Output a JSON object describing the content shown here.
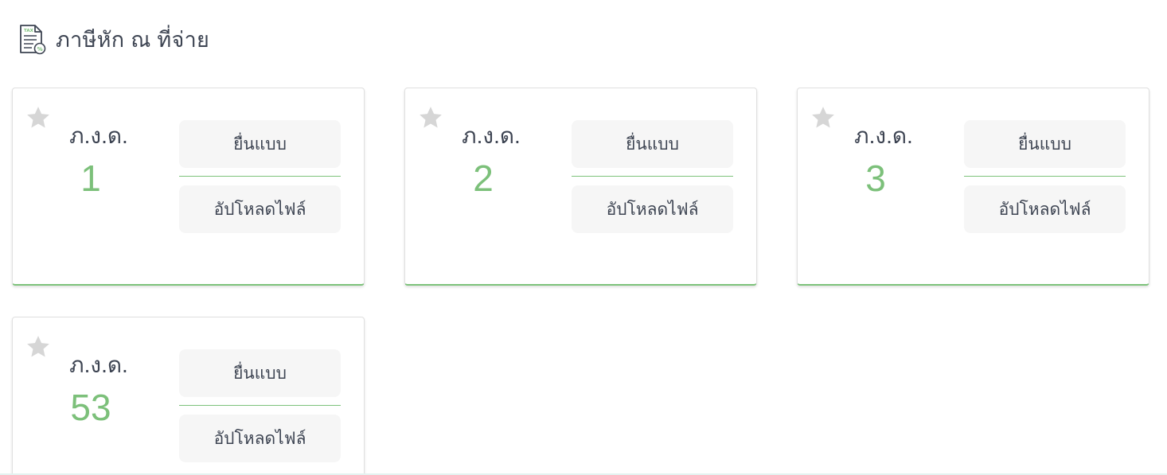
{
  "page": {
    "title": "ภาษีหัก ณ ที่จ่าย"
  },
  "colors": {
    "accent": "#7cc07a",
    "text": "#3d4452",
    "button_bg": "#f6f6f6",
    "star": "#d6d6d6"
  },
  "cards": [
    {
      "label": "ภ.ง.ด.",
      "number": "1",
      "file_button": "ยื่นแบบ",
      "upload_button": "อัปโหลดไฟล์"
    },
    {
      "label": "ภ.ง.ด.",
      "number": "2",
      "file_button": "ยื่นแบบ",
      "upload_button": "อัปโหลดไฟล์"
    },
    {
      "label": "ภ.ง.ด.",
      "number": "3",
      "file_button": "ยื่นแบบ",
      "upload_button": "อัปโหลดไฟล์"
    },
    {
      "label": "ภ.ง.ด.",
      "number": "53",
      "file_button": "ยื่นแบบ",
      "upload_button": "อัปโหลดไฟล์"
    }
  ]
}
